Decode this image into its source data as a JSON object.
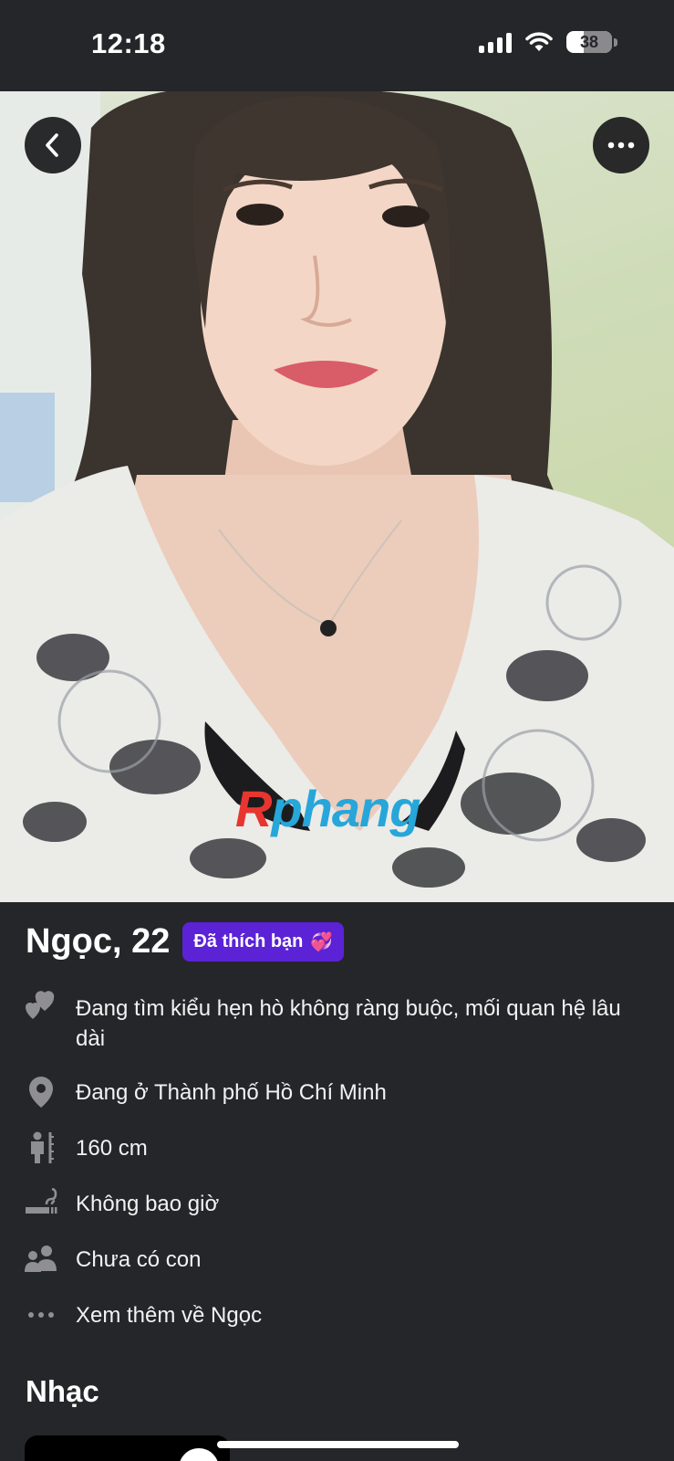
{
  "status_bar": {
    "time": "12:18",
    "battery_level": "38",
    "icons": [
      "cellular-signal-icon",
      "wifi-icon",
      "battery-icon"
    ]
  },
  "photo": {
    "watermark_part1": "R",
    "watermark_part2": "phang",
    "back_icon": "chevron-left-icon",
    "more_icon": "ellipsis-icon"
  },
  "profile": {
    "name_age": "Ngọc, 22",
    "liked_badge": "Đã thích bạn",
    "liked_emoji": "💞",
    "details": [
      {
        "icon": "hearts-icon",
        "text": "Đang tìm kiểu hẹn hò không ràng buộc, mối quan hệ lâu dài"
      },
      {
        "icon": "location-pin-icon",
        "text": "Đang ở Thành phố Hồ Chí Minh"
      },
      {
        "icon": "height-icon",
        "text": "160 cm"
      },
      {
        "icon": "smoking-icon",
        "text": "Không bao giờ"
      },
      {
        "icon": "children-icon",
        "text": "Chưa có con"
      },
      {
        "icon": "ellipsis-icon",
        "text": "Xem thêm về Ngọc"
      }
    ]
  },
  "music": {
    "section_title": "Nhạc"
  },
  "colors": {
    "background": "#252629",
    "badge": "#5b22d6",
    "watermark_red": "#e8352f",
    "watermark_blue": "#27a6d9"
  }
}
